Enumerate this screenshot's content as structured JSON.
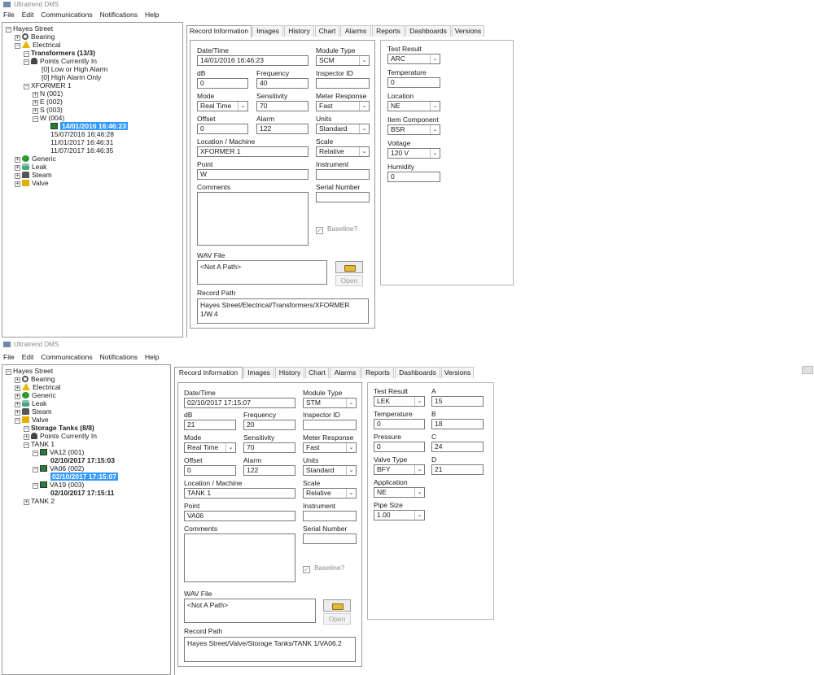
{
  "app_title": "Ultratrend DMS",
  "menu": [
    "File",
    "Edit",
    "Communications",
    "Notifications",
    "Help"
  ],
  "tabs": [
    "Record Information",
    "Images",
    "History",
    "Chart",
    "Alarms",
    "Reports",
    "Dashboards",
    "Versions"
  ],
  "labels": {
    "date_time": "Date/Time",
    "module_type": "Module Type",
    "db": "dB",
    "frequency": "Frequency",
    "inspector_id": "Inspector ID",
    "mode": "Mode",
    "sensitivity": "Sensitivity",
    "meter_response": "Meter Response",
    "offset": "Offset",
    "alarm": "Alarm",
    "units": "Units",
    "location_machine": "Location / Machine",
    "scale": "Scale",
    "point": "Point",
    "instrument": "Instrument",
    "comments": "Comments",
    "serial_number": "Serial Number",
    "baseline": "Baseline?",
    "wav_file": "WAV File",
    "open": "Open",
    "record_path": "Record Path",
    "test_result": "Test Result"
  },
  "window1": {
    "tree": [
      {
        "text": "Hayes Street",
        "exp": "-",
        "icon": ""
      },
      {
        "text": "Bearing",
        "exp": "+",
        "icon": "ring"
      },
      {
        "text": "Electrical",
        "exp": "-",
        "icon": "warn"
      },
      {
        "text": "Transformers (13/3)",
        "exp": "-",
        "icon": "",
        "bold": true
      },
      {
        "text": "Points Currently In",
        "exp": "-",
        "icon": "bell"
      },
      {
        "text": "[0] Low or High Alarm",
        "exp": "",
        "icon": ""
      },
      {
        "text": "[0] High Alarm Only",
        "exp": "",
        "icon": ""
      },
      {
        "text": "XFORMER 1",
        "exp": "-",
        "icon": ""
      },
      {
        "text": "N (001)",
        "exp": "+",
        "icon": ""
      },
      {
        "text": "E (002)",
        "exp": "+",
        "icon": ""
      },
      {
        "text": "S (003)",
        "exp": "+",
        "icon": ""
      },
      {
        "text": "W (004)",
        "exp": "-",
        "icon": ""
      },
      {
        "text": "14/01/2016 16:46:23",
        "exp": "",
        "icon": "monitor",
        "sel": true
      },
      {
        "text": "15/07/2016 16:46:28",
        "exp": "",
        "icon": ""
      },
      {
        "text": "11/01/2017 16:46:31",
        "exp": "",
        "icon": ""
      },
      {
        "text": "11/07/2017 16:46:35",
        "exp": "",
        "icon": ""
      },
      {
        "text": "Generic",
        "exp": "+",
        "icon": "generic"
      },
      {
        "text": "Leak",
        "exp": "+",
        "icon": "leak"
      },
      {
        "text": "Steam",
        "exp": "+",
        "icon": "steam"
      },
      {
        "text": "Valve",
        "exp": "+",
        "icon": "valve"
      }
    ],
    "record": {
      "date_time": "14/01/2016 16:46:23",
      "module_type": "SCM",
      "db": "0",
      "frequency": "40",
      "inspector_id": "",
      "mode": "Real Time",
      "sensitivity": "70",
      "meter_response": "Fast",
      "offset": "0",
      "alarm": "122",
      "units": "Standard",
      "location_machine": "XFORMER 1",
      "scale": "Relative",
      "point": "W",
      "instrument": "",
      "serial_number": "",
      "wav_file": "<Not A Path>",
      "record_path": "Hayes Street/Electrical/Transformers/XFORMER 1/W.4"
    },
    "details": {
      "test_result_label": "Test Result",
      "test_result": "ARC",
      "temperature_label": "Temperature",
      "temperature": "0",
      "location_label": "Location",
      "location": "NE",
      "item_component_label": "Item Component",
      "item_component": "BSR",
      "voltage_label": "Voltage",
      "voltage": "120 V",
      "humidity_label": "Humidity",
      "humidity": "0"
    }
  },
  "window2": {
    "tree": [
      {
        "text": "Hayes Street",
        "exp": "-",
        "icon": ""
      },
      {
        "text": "Bearing",
        "exp": "+",
        "icon": "ring"
      },
      {
        "text": "Electrical",
        "exp": "+",
        "icon": "warn"
      },
      {
        "text": "Generic",
        "exp": "+",
        "icon": "generic"
      },
      {
        "text": "Leak",
        "exp": "+",
        "icon": "leak"
      },
      {
        "text": "Steam",
        "exp": "+",
        "icon": "steam"
      },
      {
        "text": "Valve",
        "exp": "-",
        "icon": "valve"
      },
      {
        "text": "Storage Tanks (8/8)",
        "exp": "-",
        "icon": "",
        "bold": true
      },
      {
        "text": "Points Currently In",
        "exp": "+",
        "icon": "bell"
      },
      {
        "text": "TANK 1",
        "exp": "-",
        "icon": ""
      },
      {
        "text": "VA12 (001)",
        "exp": "-",
        "icon": "monitor"
      },
      {
        "text": "02/10/2017 17:15:03",
        "exp": "",
        "icon": "",
        "bold": true
      },
      {
        "text": "VA06 (002)",
        "exp": "-",
        "icon": "monitor"
      },
      {
        "text": "02/10/2017 17:15:07",
        "exp": "",
        "icon": "",
        "sel": true
      },
      {
        "text": "VA19 (003)",
        "exp": "-",
        "icon": "monitor"
      },
      {
        "text": "02/10/2017 17:15:11",
        "exp": "",
        "icon": "",
        "bold": true
      },
      {
        "text": "TANK 2",
        "exp": "+",
        "icon": ""
      }
    ],
    "record": {
      "date_time": "02/10/2017 17:15:07",
      "module_type": "STM",
      "db": "21",
      "frequency": "20",
      "inspector_id": "",
      "mode": "Real Time",
      "sensitivity": "70",
      "meter_response": "Fast",
      "offset": "0",
      "alarm": "122",
      "units": "Standard",
      "location_machine": "TANK 1",
      "scale": "Relative",
      "point": "VA06",
      "instrument": "",
      "serial_number": "",
      "wav_file": "<Not A Path>",
      "record_path": "Hayes Street/Valve/Storage Tanks/TANK 1/VA06.2"
    },
    "details": {
      "test_result_label": "Test Result",
      "test_result": "LEK",
      "temperature_label": "Temperature",
      "temperature": "0",
      "pressure_label": "Pressure",
      "pressure": "0",
      "valve_type_label": "Valve Type",
      "valve_type": "BFY",
      "application_label": "Application",
      "application": "NE",
      "pipe_size_label": "Pipe Size",
      "pipe_size": "1.00",
      "a_label": "A",
      "a": "15",
      "b_label": "B",
      "b": "18",
      "c_label": "C",
      "c": "24",
      "d_label": "D",
      "d": "21"
    }
  }
}
